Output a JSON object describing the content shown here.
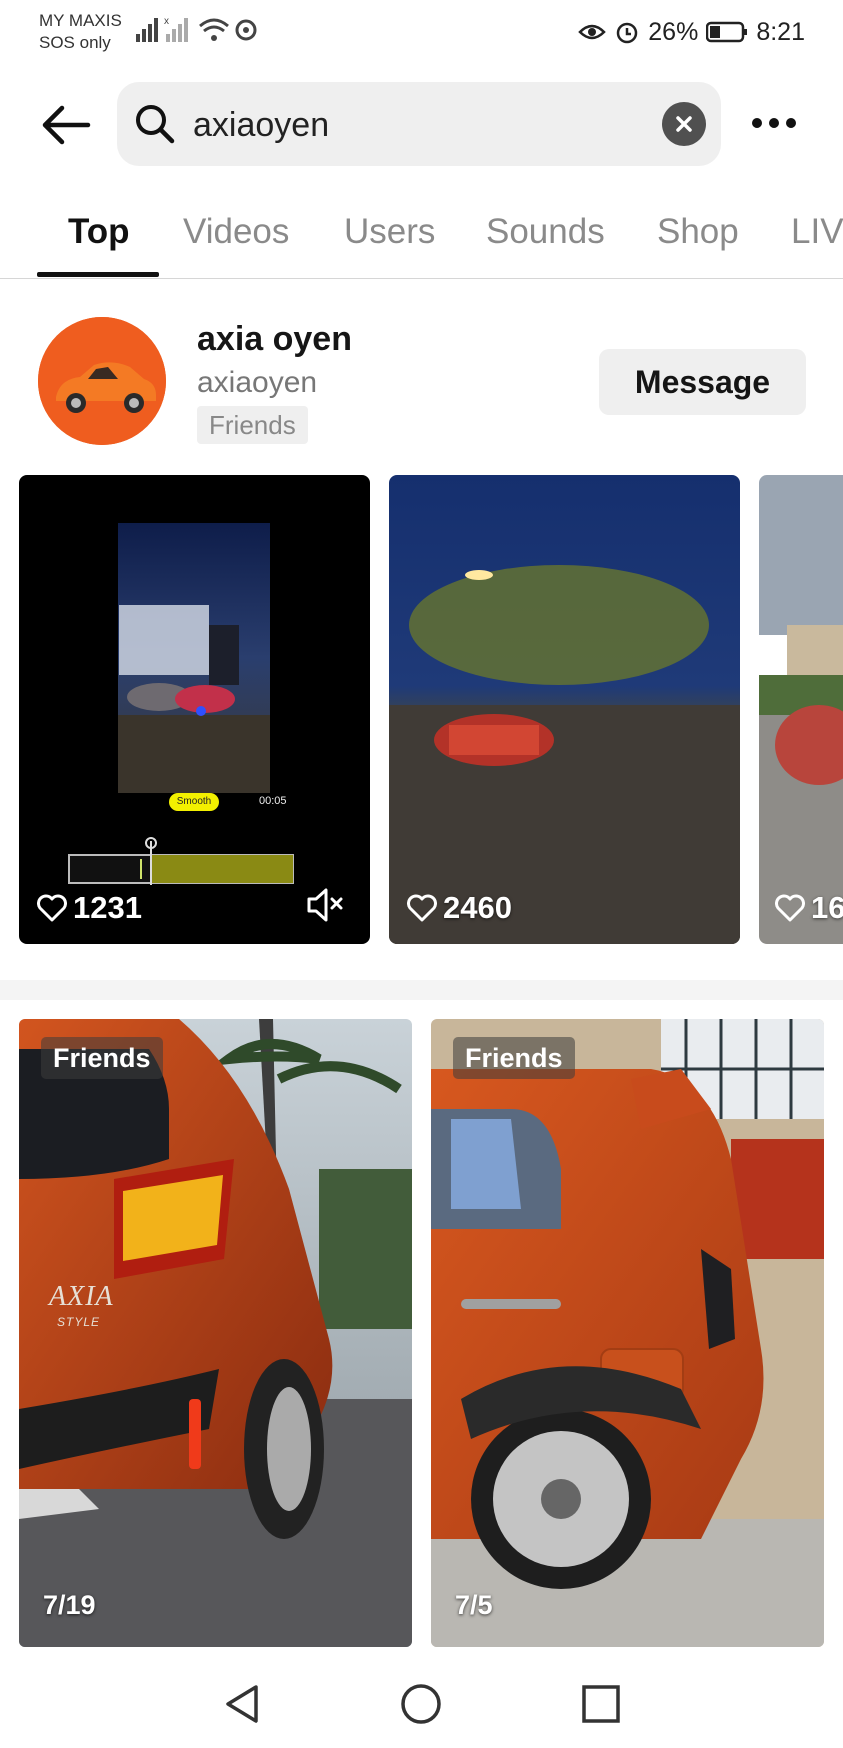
{
  "status_bar": {
    "carrier": "MY MAXIS",
    "carrier_sub": "SOS only",
    "battery": "26%",
    "time": "8:21"
  },
  "search": {
    "query": "axiaoyen",
    "icons": {
      "back": "arrow-left-icon",
      "search": "search-icon",
      "clear": "clear-icon",
      "more": "more-dots-icon"
    }
  },
  "tabs": [
    "Top",
    "Videos",
    "Users",
    "Sounds",
    "Shop",
    "LIV"
  ],
  "active_tab": "Top",
  "user": {
    "display_name": "axia oyen",
    "username": "axiaoyen",
    "badge": "Friends",
    "message_label": "Message"
  },
  "videos": [
    {
      "likes": "1231",
      "overlay_label": "Smooth",
      "overlay_time": "00:05",
      "muted": true
    },
    {
      "likes": "2460"
    },
    {
      "likes": "16"
    }
  ],
  "posts": [
    {
      "badge": "Friends",
      "date": "7/19",
      "car_badge": "AXIA",
      "car_badge_sub": "STYLE"
    },
    {
      "badge": "Friends",
      "date": "7/5"
    }
  ],
  "colors": {
    "accent_orange": "#ef5d1f",
    "chip_bg": "#efefef",
    "muted_text": "#8a8a8a"
  }
}
